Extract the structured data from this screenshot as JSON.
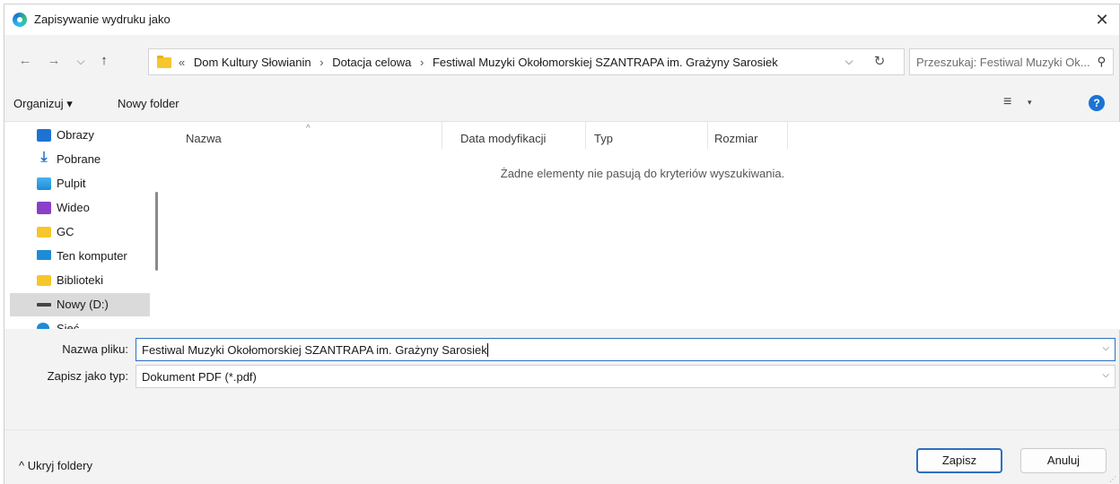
{
  "window": {
    "title": "Zapisywanie wydruku jako",
    "close_glyph": "✕"
  },
  "nav": {
    "back": "←",
    "forward": "→",
    "recent": "⌵",
    "up": "↑",
    "address_prefix": "«",
    "breadcrumbs": [
      "Dom Kultury Słowianin",
      "Dotacja celowa",
      "Festiwal Muzyki Okołomorskiej SZANTRAPA im. Grażyny Sarosiek"
    ],
    "separator": "›",
    "dropdown": "⌵",
    "refresh": "↻",
    "search_placeholder": "Przeszukaj: Festiwal Muzyki Ok...",
    "search_icon": "⚲"
  },
  "toolbar": {
    "organize": "Organizuj ▾",
    "new_folder": "Nowy folder",
    "view_icon": "≡",
    "view_dropdown": "▾",
    "help": "?"
  },
  "sidebar": {
    "items": [
      {
        "label": "Obrazy",
        "icon": "pictures-icon",
        "color": "#1e73d2"
      },
      {
        "label": "Pobrane",
        "icon": "download-icon",
        "color": "#1e73d2"
      },
      {
        "label": "Pulpit",
        "icon": "desktop-icon",
        "color": "#1e8bd6"
      },
      {
        "label": "Wideo",
        "icon": "video-icon",
        "color": "#8a3fc8"
      },
      {
        "label": "GC",
        "icon": "folder-icon",
        "color": "#f6c62c"
      },
      {
        "label": "Ten komputer",
        "icon": "computer-icon",
        "color": "#1e8bd6"
      },
      {
        "label": "Biblioteki",
        "icon": "libraries-icon",
        "color": "#f6c62c"
      },
      {
        "label": "Nowy (D:)",
        "icon": "drive-icon",
        "color": "#444444",
        "selected": true
      },
      {
        "label": "Sieć",
        "icon": "network-icon",
        "color": "#1e8bd6"
      }
    ]
  },
  "filelist": {
    "columns": [
      "Nazwa",
      "Data modyfikacji",
      "Typ",
      "Rozmiar"
    ],
    "sort_indicator": "^",
    "empty_message": "Żadne elementy nie pasują do kryteriów wyszukiwania."
  },
  "form": {
    "filename_label": "Nazwa pliku:",
    "filename_value": "Festiwal Muzyki Okołomorskiej SZANTRAPA im. Grażyny Sarosiek",
    "type_label": "Zapisz jako typ:",
    "type_value": "Dokument PDF (*.pdf)",
    "dropdown_glyph": "⌵"
  },
  "footer": {
    "hide_folders": "^ Ukryj foldery",
    "save": "Zapisz",
    "cancel": "Anuluj"
  },
  "colors": {
    "accent": "#2d6fc1",
    "help": "#1b73d3"
  }
}
